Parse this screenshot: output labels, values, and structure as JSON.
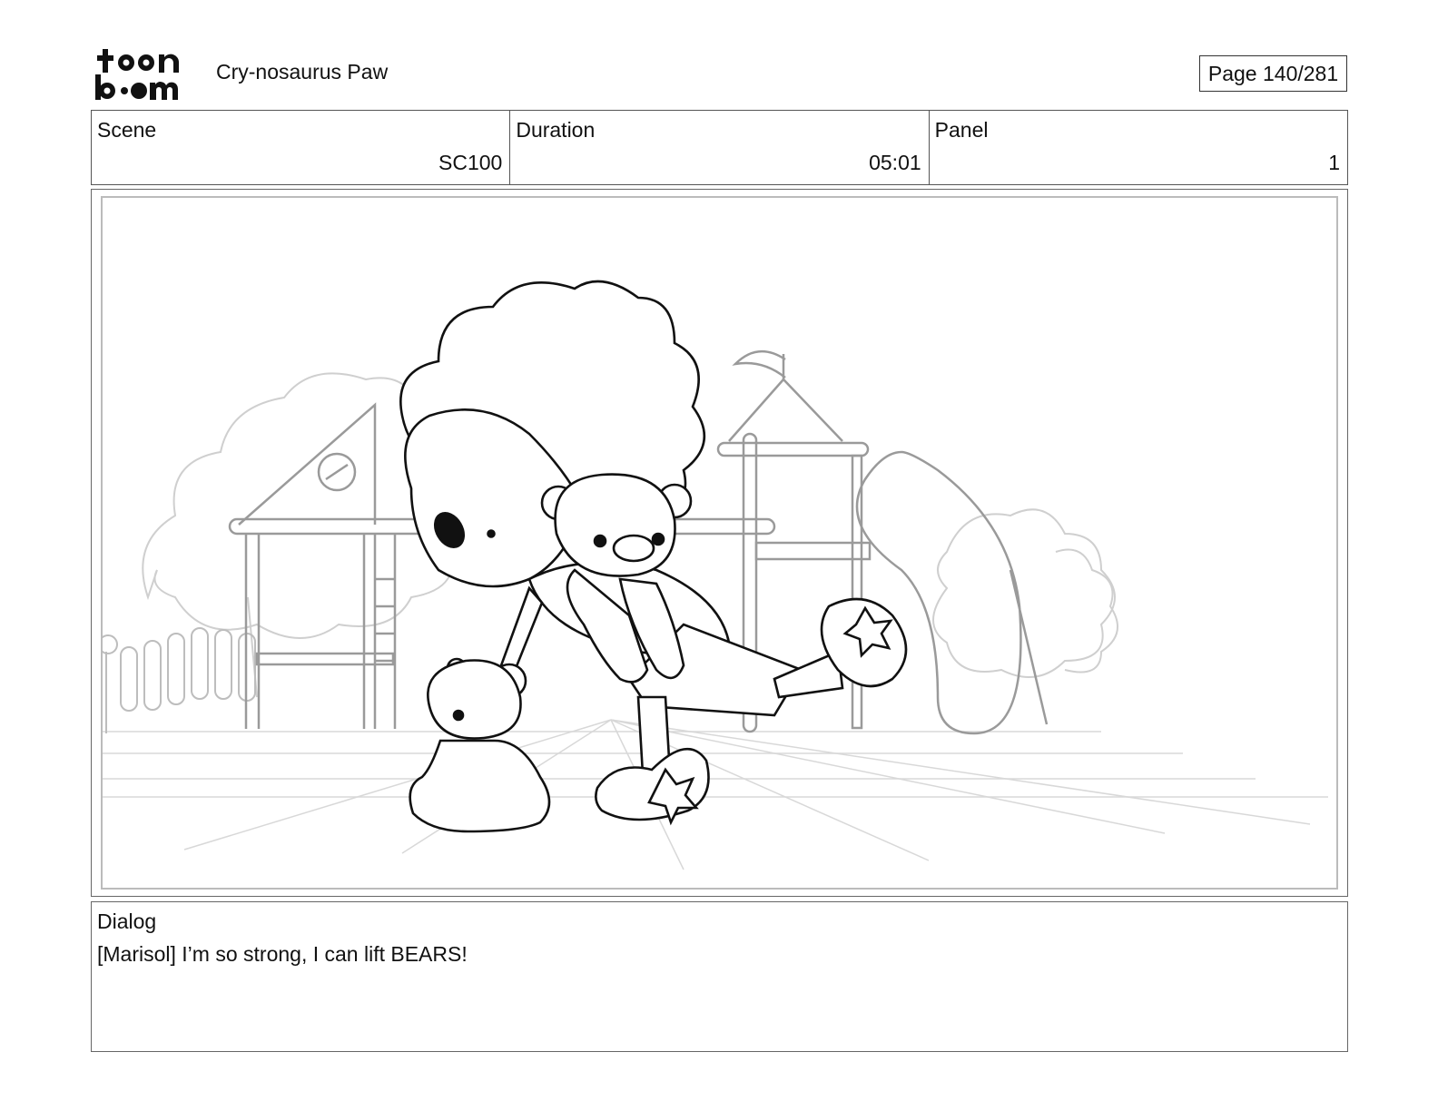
{
  "header": {
    "logo_text": [
      "toon",
      "boom"
    ],
    "project_title": "Cry-nosaurus Paw",
    "page_indicator": "Page 140/281"
  },
  "info": {
    "scene_label": "Scene",
    "scene_value": "SC100",
    "duration_label": "Duration",
    "duration_value": "05:01",
    "panel_label": "Panel",
    "panel_value": "1"
  },
  "dialog": {
    "label": "Dialog",
    "text": "[Marisol] I’m so strong, I can lift BEARS!"
  },
  "icons": {
    "logo": "toon-boom-logo"
  }
}
